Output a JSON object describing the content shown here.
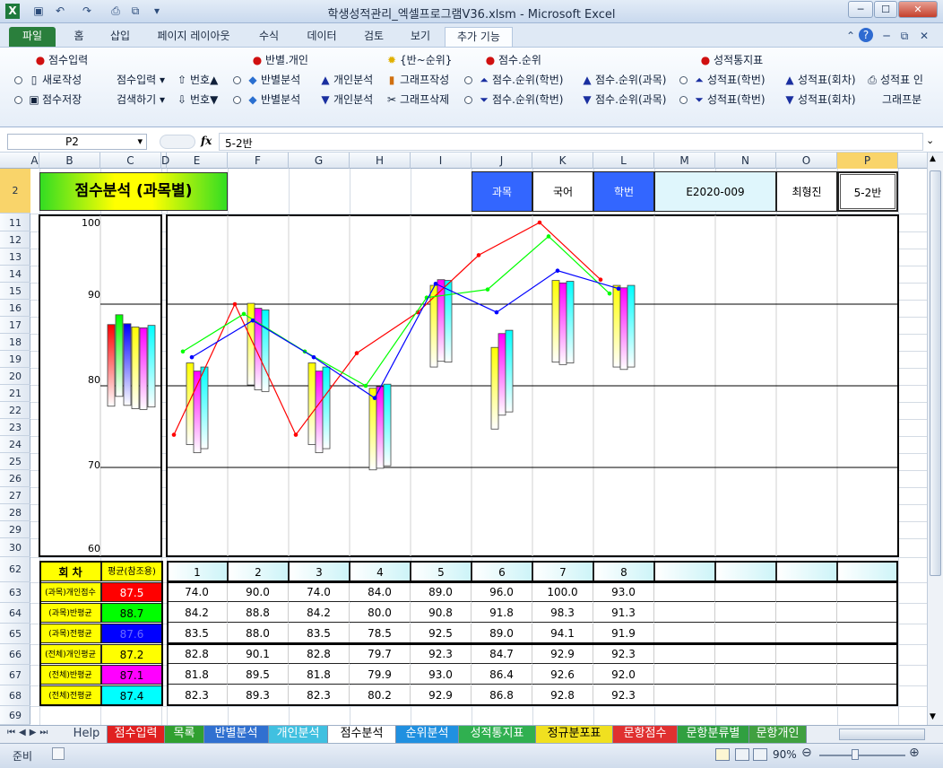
{
  "window": {
    "title": "학생성적관리_엑셀프로그램V36.xlsm  -  Microsoft Excel",
    "minimize": "─",
    "maximize": "☐",
    "close": "✕"
  },
  "ribbon_tabs": [
    "파일",
    "홈",
    "삽입",
    "페이지 레이아웃",
    "수식",
    "데이터",
    "검토",
    "보기",
    "추가 기능"
  ],
  "ribbon": {
    "g1_title": "점수입력",
    "new": "새로작성",
    "save": "점수저장",
    "score_input": "점수입력",
    "search": "검색하기",
    "num_up": "번호▲",
    "num_down": "번호▼",
    "g2_title": "반별.개인",
    "class_analysis1": "반별분석",
    "class_analysis2": "반별분석",
    "personal1": "개인분석",
    "personal2": "개인분석",
    "graph_make": "그래프작성",
    "graph_delete": "그래프삭제",
    "g3_title": "{반~순위}",
    "g4_title": "점수.순위",
    "rank_num1": "점수.순위(학번)",
    "rank_num2": "점수.순위(학번)",
    "rank_subj1": "점수.순위(과목)",
    "rank_subj2": "점수.순위(과목)",
    "g5_title": "성적통지표",
    "rep_num1": "성적표(학번)",
    "rep_num2": "성적표(학번)",
    "rep_round1": "성적표(회차)",
    "rep_round2": "성적표(회차)",
    "rep_print": "성적표 인",
    "graph_b": "그래프분"
  },
  "formula": {
    "name_box": "P2",
    "fx": "fx",
    "value": "5-2반"
  },
  "columns": [
    "A",
    "B",
    "C",
    "D",
    "E",
    "F",
    "G",
    "H",
    "I",
    "J",
    "K",
    "L",
    "M",
    "N",
    "O",
    "P"
  ],
  "rows": [
    "2",
    "11",
    "12",
    "13",
    "14",
    "15",
    "16",
    "17",
    "18",
    "19",
    "20",
    "21",
    "22",
    "23",
    "24",
    "25",
    "26",
    "27",
    "28",
    "29",
    "30",
    "62",
    "63",
    "64",
    "65",
    "66",
    "67",
    "68",
    "69"
  ],
  "header": {
    "title": "점수분석 (과목별)",
    "subject_label": "과목",
    "subject": "국어",
    "id_label": "학번",
    "id": "E2020-009",
    "name": "최형진",
    "class": "5-2반"
  },
  "axis_ticks": [
    "100",
    "90",
    "80",
    "70",
    "60"
  ],
  "table": {
    "h1": "회    차",
    "h2": "평균(참조용)",
    "rounds": [
      "1",
      "2",
      "3",
      "4",
      "5",
      "6",
      "7",
      "8"
    ],
    "rows": [
      {
        "label": "(과목)개인점수",
        "avg": "87.5",
        "color": "#ff0000",
        "tcolor": "#ffffff",
        "vals": [
          "74.0",
          "90.0",
          "74.0",
          "84.0",
          "89.0",
          "96.0",
          "100.0",
          "93.0"
        ]
      },
      {
        "label": "(과목)반평균",
        "avg": "88.7",
        "color": "#00ff00",
        "tcolor": "#000000",
        "vals": [
          "84.2",
          "88.8",
          "84.2",
          "80.0",
          "90.8",
          "91.8",
          "98.3",
          "91.3"
        ]
      },
      {
        "label": "(과목)전평균",
        "avg": "87.6",
        "color": "#0000ff",
        "tcolor": "#6a6aff",
        "vals": [
          "83.5",
          "88.0",
          "83.5",
          "78.5",
          "92.5",
          "89.0",
          "94.1",
          "91.9"
        ]
      },
      {
        "label": "(전체)개인평균",
        "avg": "87.2",
        "color": "#ffff00",
        "tcolor": "#000000",
        "vals": [
          "82.8",
          "90.1",
          "82.8",
          "79.7",
          "92.3",
          "84.7",
          "92.9",
          "92.3"
        ]
      },
      {
        "label": "(전체)반평균",
        "avg": "87.1",
        "color": "#ff00ff",
        "tcolor": "#000000",
        "vals": [
          "81.8",
          "89.5",
          "81.8",
          "79.9",
          "93.0",
          "86.4",
          "92.6",
          "92.0"
        ]
      },
      {
        "label": "(전체)전평균",
        "avg": "87.4",
        "color": "#00ffff",
        "tcolor": "#000000",
        "vals": [
          "82.3",
          "89.3",
          "82.3",
          "80.2",
          "92.9",
          "86.8",
          "92.8",
          "92.3"
        ]
      }
    ]
  },
  "chart_data": {
    "type": "line",
    "categories": [
      "1",
      "2",
      "3",
      "4",
      "5",
      "6",
      "7",
      "8"
    ],
    "ylim": [
      60,
      100
    ],
    "series": [
      {
        "color": "#ff0000",
        "values": [
          74.0,
          90.0,
          74.0,
          84.0,
          89.0,
          96.0,
          100.0,
          93.0
        ]
      },
      {
        "color": "#00ff00",
        "values": [
          84.2,
          88.8,
          84.2,
          80.0,
          90.8,
          91.8,
          98.3,
          91.3
        ]
      },
      {
        "color": "#0000ff",
        "values": [
          83.5,
          88.0,
          83.5,
          78.5,
          92.5,
          89.0,
          94.1,
          91.9
        ]
      },
      {
        "color": "#ffff00",
        "values": [
          82.8,
          90.1,
          82.8,
          79.7,
          92.3,
          84.7,
          92.9,
          92.3
        ]
      },
      {
        "color": "#ff00ff",
        "values": [
          81.8,
          89.5,
          81.8,
          79.9,
          93.0,
          86.4,
          92.6,
          92.0
        ]
      },
      {
        "color": "#00ffff",
        "values": [
          82.3,
          89.3,
          82.3,
          80.2,
          92.9,
          86.8,
          92.8,
          92.3
        ]
      }
    ],
    "avg_values": [
      87.5,
      88.7,
      87.6,
      87.2,
      87.1,
      87.4
    ]
  },
  "sheet_tabs": [
    {
      "label": "Help",
      "bg": "#e9eef5",
      "fg": "#30405a"
    },
    {
      "label": "점수입력",
      "bg": "#e02020",
      "fg": "#ffffff"
    },
    {
      "label": "목록",
      "bg": "#30a030",
      "fg": "#ffffff"
    },
    {
      "label": "반별분석",
      "bg": "#3070d0",
      "fg": "#ffffff"
    },
    {
      "label": "개인분석",
      "bg": "#40c0e0",
      "fg": "#ffffff"
    },
    {
      "label": "점수분석",
      "bg": "#ffffff",
      "fg": "#000000"
    },
    {
      "label": "순위분석",
      "bg": "#2090e0",
      "fg": "#ffffff"
    },
    {
      "label": "성적통지표",
      "bg": "#30b050",
      "fg": "#ffffff"
    },
    {
      "label": "정규분포표",
      "bg": "#f0e020",
      "fg": "#000000"
    },
    {
      "label": "문항점수",
      "bg": "#e03030",
      "fg": "#ffffff"
    },
    {
      "label": "문항분류별",
      "bg": "#30a040",
      "fg": "#ffffff"
    },
    {
      "label": "문항개인",
      "bg": "#40a040",
      "fg": "#ffffff"
    }
  ],
  "status": {
    "ready": "준비",
    "zoom": "90%"
  }
}
